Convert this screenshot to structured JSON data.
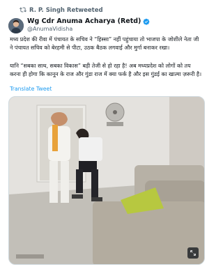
{
  "retweet": {
    "label": "R. P. Singh Retweeted",
    "icon": "retweet-icon"
  },
  "author": {
    "name": "Wg Cdr Anuma Acharya (Retd)",
    "handle": "@AnumaVidisha",
    "verified": true,
    "verified_color": "#1d9bf0"
  },
  "tweet": {
    "paragraph_1": "मध्य प्रदेश की रीवा में पंचायत के सचिव ने “हिस्सा” नहीं पहुंचाया तो भाजपा के जोशीले नेता जी ने पंचायत सचिव को बेरहमी से पीटा, उठक बैठक लगवाई और मुर्गा बनाकर रखा।",
    "paragraph_2": "यानि “सबका साथ, सबका विकास” बड़ी तेजी से हो रहा है! अब मध्यप्रदेश को लोगों को तय करना ही होगा कि कानून के राज और गुंडा राज में क्या फर्क है और इस गुंडई का खात्मा ज़रूरी है।",
    "translate_link": "Translate Tweet"
  },
  "media": {
    "type": "video-still",
    "expand_icon": "expand-icon"
  },
  "colors": {
    "text": "#0f1419",
    "muted": "#536471",
    "link": "#1d9bf0"
  }
}
